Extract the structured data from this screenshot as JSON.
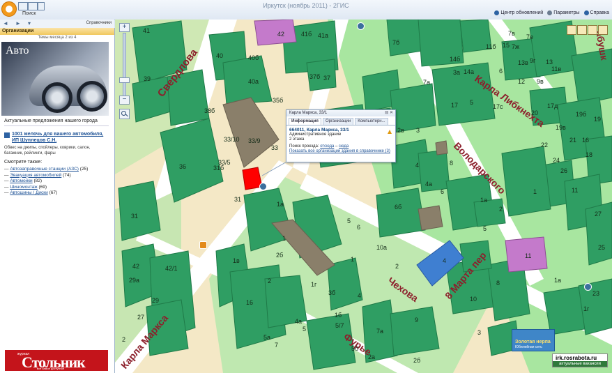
{
  "window": {
    "title": "Иркутск (ноябрь 2011) - 2ГИС"
  },
  "toolbar": {
    "search_label": "Поиск"
  },
  "header_links": {
    "updates": "Центр обновлений",
    "params": "Параметры",
    "help": "Справка"
  },
  "nav": {
    "reference": "Справочники"
  },
  "sidebar": {
    "header": "Организации",
    "theme": "Темы месяца 2 из 4",
    "banner_title": "Авто",
    "banner_caption": "Актуальные предложения нашего города",
    "firm_link": "1001 мелочь для вашего автомобиля, ИП Шуплецов С.Н.",
    "firm_desc": "Обвес на джипы, спойлеры, коврики, салон, багажник, рейлинги, фары",
    "see_also": "Смотрите также:",
    "categories": [
      {
        "name": "Автозаправочные станции (АЗС)",
        "count": "(25)"
      },
      {
        "name": "Эвакуация автомобилей",
        "count": "(74)"
      },
      {
        "name": "Автомойки",
        "count": "(82)"
      },
      {
        "name": "Шиномонтаж",
        "count": "(69)"
      },
      {
        "name": "Автошины / Диски",
        "count": "(67)"
      }
    ],
    "ad": {
      "small": "журнал",
      "big": "Стольник",
      "sub": "все самое доступное"
    }
  },
  "map": {
    "streets": [
      "Свердлова",
      "Карла Либкнехта",
      "Володарского",
      "8 Марта пер",
      "Чехова",
      "Фурье",
      "Карла Маркса",
      "абушк"
    ],
    "labels": [
      "41",
      "42",
      "41б",
      "41а",
      "40",
      "40б",
      "39",
      "40а",
      "37б",
      "37",
      "35б",
      "38б",
      "33/10",
      "33/9",
      "33",
      "33/5",
      "31б",
      "36",
      "31",
      "31",
      "42б",
      "42",
      "42/1",
      "29а",
      "29",
      "27",
      "2",
      "1а",
      "1",
      "2б",
      "2",
      "1в",
      "1г",
      "3б",
      "4",
      "16",
      "4а",
      "1б",
      "5",
      "5/7",
      "5а",
      "7",
      "7а",
      "5б",
      "2а",
      "2б",
      "2в",
      "2б",
      "4",
      "3",
      "4а",
      "6б",
      "8",
      "6",
      "1а",
      "3а",
      "5",
      "6",
      "10а",
      "1",
      "2",
      "4",
      "10",
      "8",
      "11",
      "9",
      "2",
      "1",
      "5",
      "1а",
      "3",
      "7б",
      "7а",
      "7в",
      "7е",
      "7ж",
      "11б",
      "15",
      "13в",
      "13",
      "11в",
      "9г",
      "9в",
      "6",
      "12",
      "14б",
      "14а",
      "5",
      "17с",
      "17",
      "17д",
      "19в",
      "19б",
      "19",
      "21",
      "16",
      "18",
      "20",
      "22",
      "24",
      "26",
      "11",
      "27",
      "25",
      "23",
      "1г"
    ],
    "popup": {
      "title": "Карла Маркса, 33/1",
      "tabs": [
        "Информация",
        "Организации",
        "Компьютерн..."
      ],
      "address": "664011, Карла Маркса, 33/1",
      "building_type": "Административное здание",
      "floors": "2 этажа",
      "route_label": "Поиск проезда:",
      "route_from": "отсюда",
      "route_sep": "–",
      "route_to": "сюда",
      "show_orgs": "Показать все организации здания в справочнике (3)"
    },
    "ads": {
      "zolotaya_title": "Золотая нерпа",
      "zolotaya_sub": "Юбилейная сеть",
      "rosrabota_title": "irk.rosrabota.ru",
      "rosrabota_sub": "актуальные вакансии"
    }
  },
  "colors": {
    "building": "#2f9e63",
    "selected": "#ff0000",
    "street_text": "#8c1f2b"
  }
}
